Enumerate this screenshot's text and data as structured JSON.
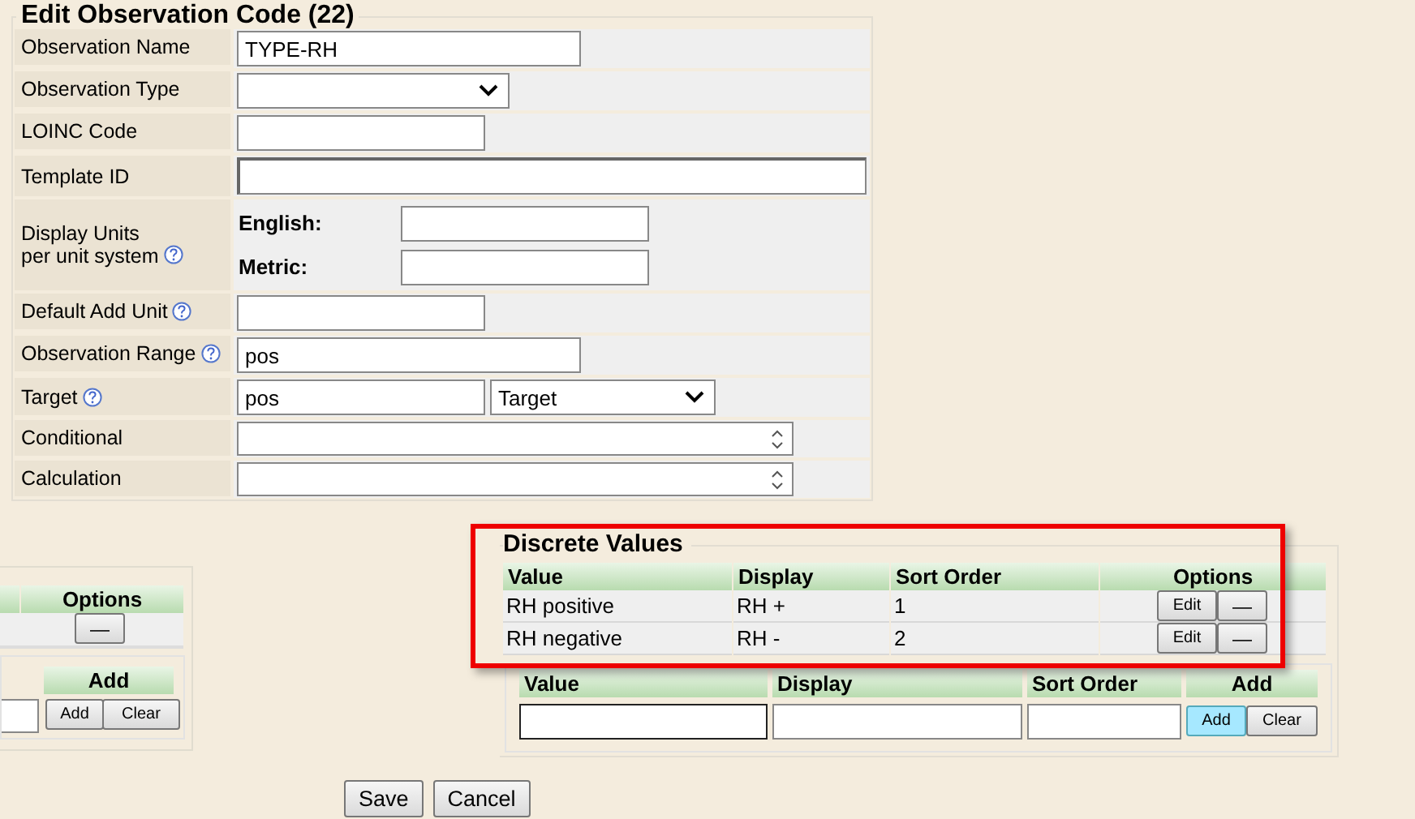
{
  "form": {
    "title": "Edit Observation Code (22)",
    "fields": [
      {
        "kind": "text",
        "label": "Observation Name",
        "help": false,
        "value": "TYPE-RH"
      },
      {
        "kind": "select",
        "label": "Observation Type",
        "help": false
      },
      {
        "kind": "text",
        "label": "LOINC Code",
        "help": false
      },
      {
        "kind": "wide_text",
        "label": "Template ID",
        "help": false
      },
      {
        "kind": "units",
        "label": "Display Units",
        "label_2": "per unit system",
        "help": true,
        "units": [
          {
            "label": "English:"
          },
          {
            "label": "Metric:"
          }
        ]
      },
      {
        "kind": "text",
        "label": "Default Add Unit",
        "help": true
      },
      {
        "kind": "text",
        "label": "Observation Range",
        "help": true,
        "value": "pos"
      },
      {
        "kind": "text_select",
        "label": "Target",
        "help": true,
        "value": "pos",
        "option": "Target"
      },
      {
        "kind": "textarea",
        "label": "Conditional",
        "help": false
      },
      {
        "kind": "textarea",
        "label": "Calculation",
        "help": false
      }
    ]
  },
  "left_panel": {
    "options_header": "Options",
    "remove_button": "—",
    "add_header": "Add",
    "add_button": "Add",
    "clear_button": "Clear"
  },
  "discrete_values": {
    "title": "Discrete Values",
    "highlighted": true,
    "columns": [
      "Value",
      "Display",
      "Sort Order",
      "Options"
    ],
    "rows": [
      {
        "value": "RH positive",
        "display": "RH +",
        "sort_order": "1",
        "edit_button": "Edit",
        "remove_button": "—"
      },
      {
        "value": "RH negative",
        "display": "RH -",
        "sort_order": "2",
        "edit_button": "Edit",
        "remove_button": "—"
      }
    ],
    "add_form": {
      "columns": [
        "Value",
        "Display",
        "Sort Order",
        "Add"
      ],
      "add_button": "Add",
      "add_focused": true,
      "clear_button": "Clear"
    }
  },
  "buttons": [
    "Save",
    "Cancel"
  ]
}
